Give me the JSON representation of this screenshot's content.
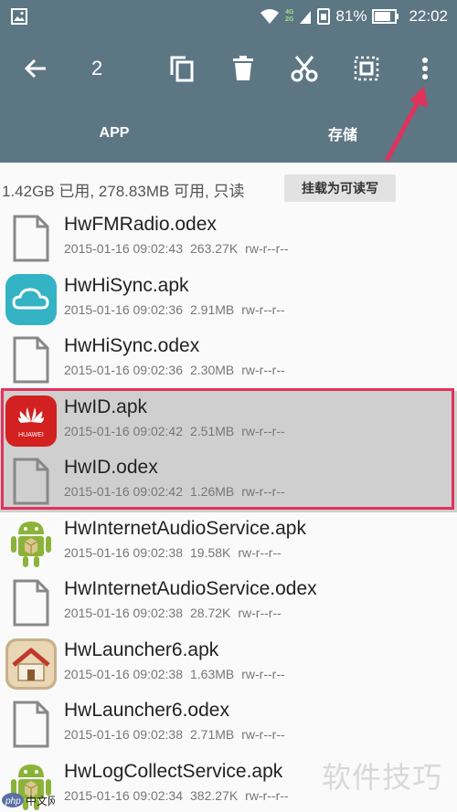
{
  "status_bar": {
    "network_top": "4G",
    "network_bottom": "2G",
    "battery": "81%",
    "time": "22:02"
  },
  "toolbar": {
    "selected_count": "2"
  },
  "tabs": [
    {
      "label": "APP"
    },
    {
      "label": "存储"
    }
  ],
  "storage": {
    "info": "1.42GB 已用, 278.83MB 可用, 只读",
    "mount_button": "挂载为可读写"
  },
  "files": [
    {
      "name": "HwFMRadio.odex",
      "date": "2015-01-16 09:02:43",
      "size": "263.27K",
      "perm": "rw-r--r--",
      "icon": "file-icon",
      "selected": false
    },
    {
      "name": "HwHiSync.apk",
      "date": "2015-01-16 09:02:36",
      "size": "2.91MB",
      "perm": "rw-r--r--",
      "icon": "cloud-app-icon",
      "selected": false
    },
    {
      "name": "HwHiSync.odex",
      "date": "2015-01-16 09:02:36",
      "size": "2.30MB",
      "perm": "rw-r--r--",
      "icon": "file-icon",
      "selected": false
    },
    {
      "name": "HwID.apk",
      "date": "2015-01-16 09:02:42",
      "size": "2.51MB",
      "perm": "rw-r--r--",
      "icon": "huawei-icon",
      "selected": true
    },
    {
      "name": "HwID.odex",
      "date": "2015-01-16 09:02:42",
      "size": "1.26MB",
      "perm": "rw-r--r--",
      "icon": "file-icon",
      "selected": true
    },
    {
      "name": "HwInternetAudioService.apk",
      "date": "2015-01-16 09:02:38",
      "size": "19.58K",
      "perm": "rw-r--r--",
      "icon": "android-icon",
      "selected": false
    },
    {
      "name": "HwInternetAudioService.odex",
      "date": "2015-01-16 09:02:38",
      "size": "28.72K",
      "perm": "rw-r--r--",
      "icon": "file-icon",
      "selected": false
    },
    {
      "name": "HwLauncher6.apk",
      "date": "2015-01-16 09:02:38",
      "size": "1.63MB",
      "perm": "rw-r--r--",
      "icon": "home-icon",
      "selected": false
    },
    {
      "name": "HwLauncher6.odex",
      "date": "2015-01-16 09:02:38",
      "size": "2.71MB",
      "perm": "rw-r--r--",
      "icon": "file-icon",
      "selected": false
    },
    {
      "name": "HwLogCollectService.apk",
      "date": "2015-01-16 09:02:34",
      "size": "382.27K",
      "perm": "rw-r--r--",
      "icon": "android-icon",
      "selected": false
    }
  ],
  "watermark": {
    "left_text": "php中文网",
    "right_text": "软件技巧"
  },
  "colors": {
    "primary": "#5c7684",
    "highlight": "#e0335c",
    "selected_row": "#cfcfcf"
  }
}
